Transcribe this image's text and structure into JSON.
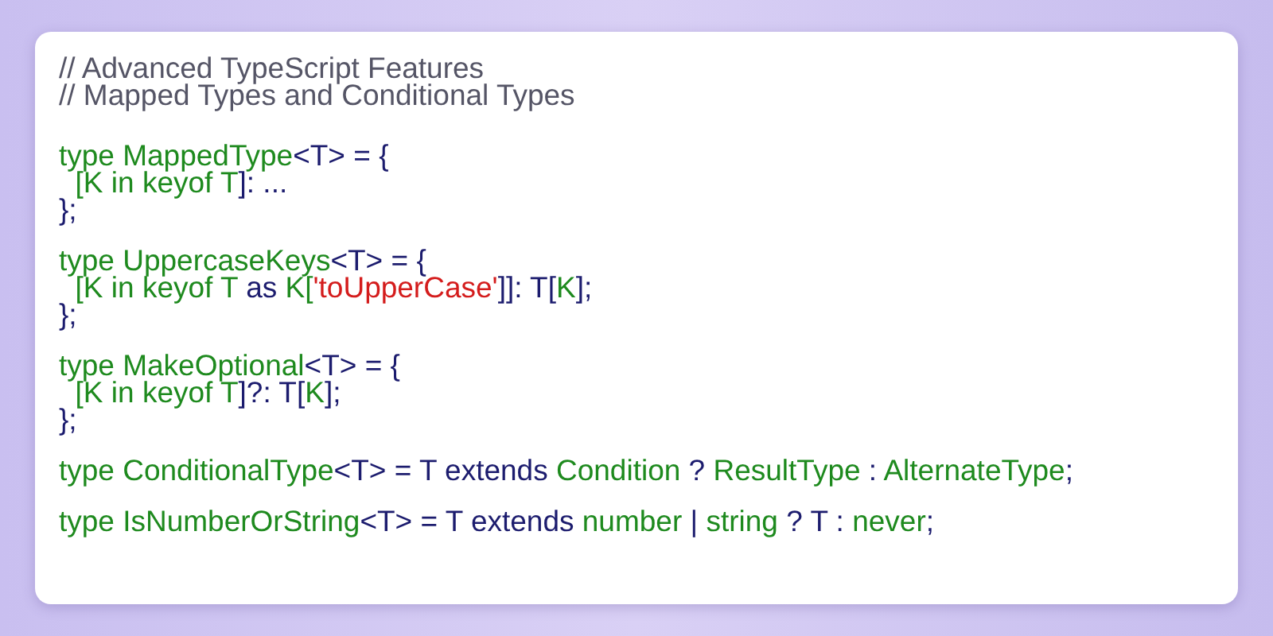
{
  "comments": [
    "// Advanced TypeScript Features",
    "// Mapped Types and Conditional Types"
  ],
  "blocks": [
    [
      [
        {
          "text": "type MappedType",
          "kind": "name"
        },
        {
          "text": "<T> = {",
          "kind": "punct"
        }
      ],
      [
        {
          "text": "  [K in keyof T",
          "kind": "name"
        },
        {
          "text": "]: ...",
          "kind": "punct"
        }
      ],
      [
        {
          "text": "};",
          "kind": "punct"
        }
      ]
    ],
    [
      [
        {
          "text": "type UppercaseKeys",
          "kind": "name"
        },
        {
          "text": "<T> = {",
          "kind": "punct"
        }
      ],
      [
        {
          "text": "  [K in keyof T ",
          "kind": "name"
        },
        {
          "text": "as ",
          "kind": "punct"
        },
        {
          "text": "K[",
          "kind": "name"
        },
        {
          "text": "'toUpperCase'",
          "kind": "string"
        },
        {
          "text": "]]: T[",
          "kind": "punct"
        },
        {
          "text": "K",
          "kind": "name"
        },
        {
          "text": "];",
          "kind": "punct"
        }
      ],
      [
        {
          "text": "};",
          "kind": "punct"
        }
      ]
    ],
    [
      [
        {
          "text": "type MakeOptional",
          "kind": "name"
        },
        {
          "text": "<T> = {",
          "kind": "punct"
        }
      ],
      [
        {
          "text": "  [K in keyof T",
          "kind": "name"
        },
        {
          "text": "]?: T[",
          "kind": "punct"
        },
        {
          "text": "K",
          "kind": "name"
        },
        {
          "text": "];",
          "kind": "punct"
        }
      ],
      [
        {
          "text": "};",
          "kind": "punct"
        }
      ]
    ],
    [
      [
        {
          "text": "type ConditionalType",
          "kind": "name"
        },
        {
          "text": "<T> = T extends ",
          "kind": "punct"
        },
        {
          "text": "Condition",
          "kind": "name"
        },
        {
          "text": " ? ",
          "kind": "punct"
        },
        {
          "text": "ResultType",
          "kind": "name"
        },
        {
          "text": " : ",
          "kind": "punct"
        },
        {
          "text": "AlternateType",
          "kind": "name"
        },
        {
          "text": ";",
          "kind": "punct"
        }
      ]
    ],
    [
      [
        {
          "text": "type IsNumberOrString",
          "kind": "name"
        },
        {
          "text": "<T> = T extends ",
          "kind": "punct"
        },
        {
          "text": "number",
          "kind": "name"
        },
        {
          "text": " | ",
          "kind": "punct"
        },
        {
          "text": "string",
          "kind": "name"
        },
        {
          "text": " ? T : ",
          "kind": "punct"
        },
        {
          "text": "never",
          "kind": "name"
        },
        {
          "text": ";",
          "kind": "punct"
        }
      ]
    ]
  ]
}
